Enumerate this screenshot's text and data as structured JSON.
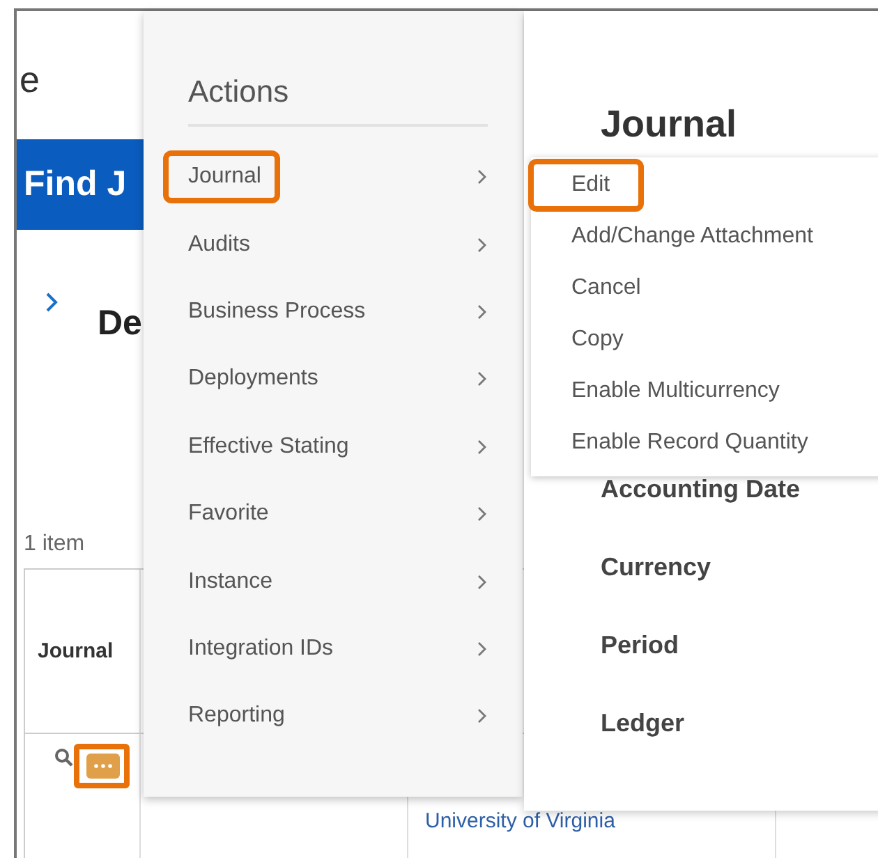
{
  "page": {
    "title_fragment": "e",
    "banner": "Find J",
    "heading_fragment": "De",
    "item_count": "1 item"
  },
  "table": {
    "columns": [
      "Journal"
    ],
    "rows": [
      {
        "actions_highlighted": true,
        "column_3": "University of Virginia"
      }
    ]
  },
  "actions_menu": {
    "title": "Actions",
    "items": [
      {
        "label": "Journal",
        "highlighted": true
      },
      {
        "label": "Audits",
        "highlighted": false
      },
      {
        "label": "Business Process",
        "highlighted": false
      },
      {
        "label": "Deployments",
        "highlighted": false
      },
      {
        "label": "Effective Stating",
        "highlighted": false
      },
      {
        "label": "Favorite",
        "highlighted": false
      },
      {
        "label": "Instance",
        "highlighted": false
      },
      {
        "label": "Integration IDs",
        "highlighted": false
      },
      {
        "label": "Reporting",
        "highlighted": false
      }
    ]
  },
  "details_card": {
    "title": "Journal",
    "fields": [
      "Accounting Date",
      "Currency",
      "Period",
      "Ledger"
    ]
  },
  "submenu": {
    "items": [
      {
        "label": "Edit",
        "highlighted": true
      },
      {
        "label": "Add/Change Attachment",
        "highlighted": false
      },
      {
        "label": "Cancel",
        "highlighted": false
      },
      {
        "label": "Copy",
        "highlighted": false
      },
      {
        "label": "Enable Multicurrency",
        "highlighted": false
      },
      {
        "label": "Enable Record Quantity",
        "highlighted": false
      }
    ]
  }
}
